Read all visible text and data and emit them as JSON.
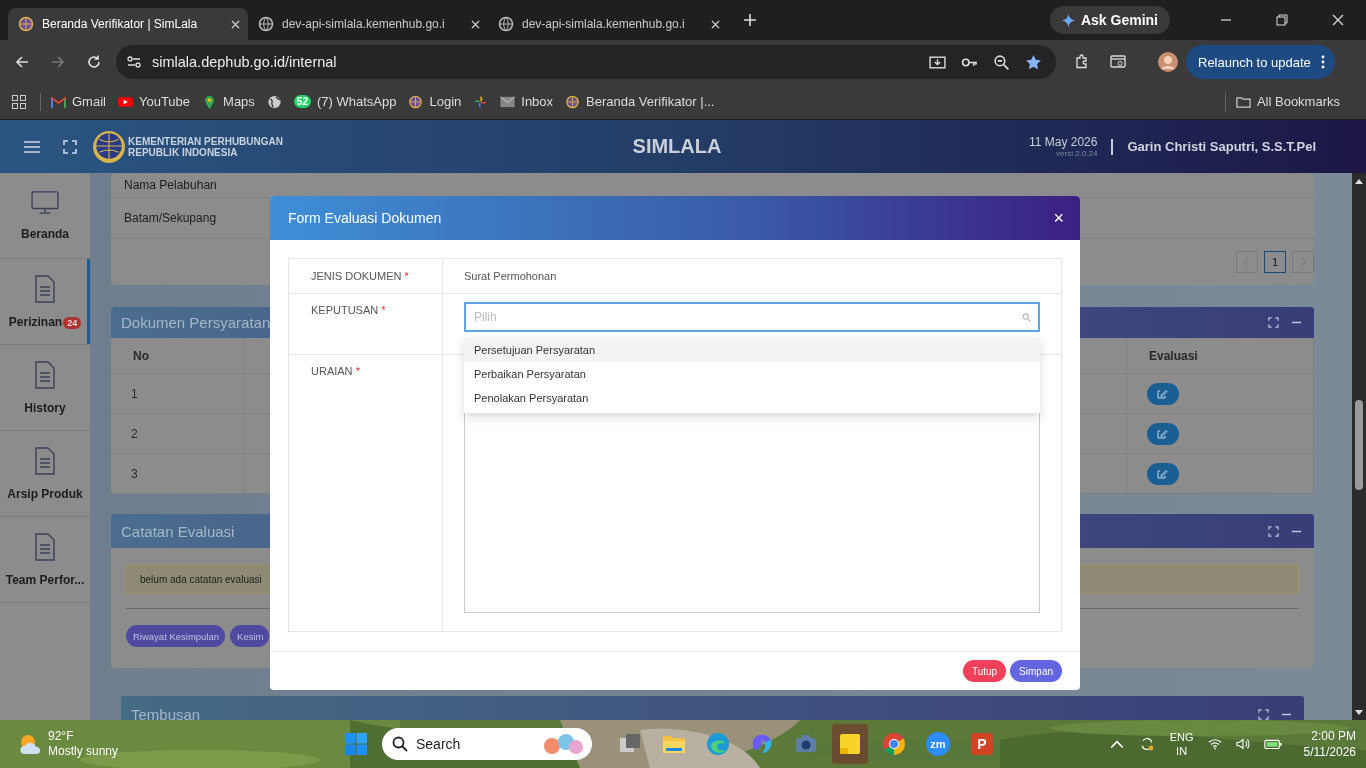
{
  "browser": {
    "tabs": [
      {
        "title": "Beranda Verifikator | SimLala",
        "selected": true
      },
      {
        "title": "dev-api-simlala.kemenhub.go.i",
        "selected": false
      },
      {
        "title": "dev-api-simlala.kemenhub.go.i",
        "selected": false
      }
    ],
    "gemini": "Ask Gemini",
    "url": "simlala.dephub.go.id/internal",
    "relaunch": "Relaunch to update",
    "bookmarks": [
      {
        "kind": "gmail",
        "label": "Gmail"
      },
      {
        "kind": "youtube",
        "label": "YouTube"
      },
      {
        "kind": "maps",
        "label": "Maps"
      },
      {
        "kind": "globe"
      },
      {
        "kind": "whatsapp",
        "badge": "52",
        "label": "(7) WhatsApp"
      },
      {
        "kind": "site",
        "label": "Login"
      },
      {
        "kind": "pinwheel"
      },
      {
        "kind": "mail",
        "label": "Inbox"
      },
      {
        "kind": "site",
        "label": "Beranda Verifikator |..."
      }
    ],
    "all_bookmarks": "All Bookmarks"
  },
  "header": {
    "org": [
      "KEMENTERIAN PERHUBUNGAN",
      "REPUBLIK INDONESIA"
    ],
    "title": "SIMLALA",
    "date": "11 May 2026",
    "version": "versi 2.0.24",
    "user": "Garin Christi Saputri, S.S.T.Pel"
  },
  "sidebar": [
    {
      "kind": "monitor",
      "label": "Beranda",
      "selected": false
    },
    {
      "kind": "document",
      "label": "Perizinan",
      "badge": "24",
      "selected": true
    },
    {
      "kind": "document",
      "label": "History",
      "selected": false
    },
    {
      "kind": "document",
      "label": "Arsip Produk",
      "selected": false
    },
    {
      "kind": "document",
      "label": "Team Perfor...",
      "selected": false
    }
  ],
  "port": {
    "rows": [
      "Nama Pelabuhan",
      "Batam/Sekupang"
    ],
    "pages": [
      {
        "label": "1",
        "selected": true
      }
    ]
  },
  "documents": {
    "title": "Dokumen Persyaratan",
    "columns": [
      "No",
      "Evaluasi"
    ],
    "rows": [
      {
        "no": "1"
      },
      {
        "no": "2"
      },
      {
        "no": "3"
      }
    ]
  },
  "notes": {
    "title": "Catatan Evaluasi",
    "alert": "belum ada catatan evaluasi",
    "buttons": [
      "Riwayat Kesimpulan",
      "Kesim"
    ]
  },
  "cc": {
    "title": "Tembusan"
  },
  "modal": {
    "title": "Form Evaluasi Dokumen",
    "close": "×",
    "fields": [
      {
        "kind": "text",
        "label": "JENIS DOKUMEN",
        "mark": "*",
        "value": "Surat Permohonan"
      },
      {
        "kind": "select",
        "label": "KEPUTUSAN",
        "mark": "*",
        "placeholder": "Pilih",
        "expanded": true,
        "options": [
          {
            "label": "Persetujuan Persyaratan",
            "selected": true
          },
          {
            "label": "Perbaikan Persyaratan",
            "selected": false
          },
          {
            "label": "Penolakan Persyaratan",
            "selected": false
          }
        ]
      },
      {
        "kind": "textarea",
        "label": "URAIAN",
        "mark": "*"
      }
    ],
    "buttons": [
      {
        "label": "Tutup",
        "kind": "danger"
      },
      {
        "label": "Simpan",
        "kind": "primary"
      }
    ]
  },
  "taskbar": {
    "temperature": "92°F",
    "weather": "Mostly sunny",
    "search": "Search",
    "apps": [
      {
        "kind": "taskview"
      },
      {
        "kind": "folder"
      },
      {
        "kind": "edge"
      },
      {
        "kind": "swirl"
      },
      {
        "kind": "camera"
      },
      {
        "kind": "notes",
        "selected": true
      },
      {
        "kind": "chrome"
      },
      {
        "kind": "zoom",
        "label": "zm"
      },
      {
        "kind": "ppt",
        "label": "P"
      }
    ],
    "lang": [
      "ENG",
      "IN"
    ],
    "time": "2:00 PM",
    "date": "5/11/2026"
  }
}
